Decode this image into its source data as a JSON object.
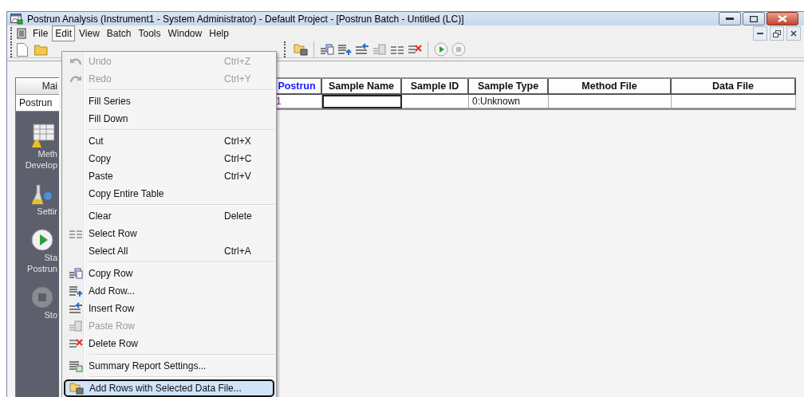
{
  "window": {
    "title": "Postrun Analysis (Instrument1 - System Administrator) - Default Project - [Postrun Batch - Untitled (LC)]"
  },
  "menubar": [
    {
      "label": "File",
      "selected": false
    },
    {
      "label": "Edit",
      "selected": true
    },
    {
      "label": "View",
      "selected": false
    },
    {
      "label": "Batch",
      "selected": false
    },
    {
      "label": "Tools",
      "selected": false
    },
    {
      "label": "Window",
      "selected": false
    },
    {
      "label": "Help",
      "selected": false
    }
  ],
  "sidebar": {
    "header": "Mai",
    "dropdown": "Postrun",
    "buttons": [
      {
        "lines": [
          "Meth",
          "Develop"
        ]
      },
      {
        "lines": [
          "Settir"
        ]
      },
      {
        "lines": [
          "Sta",
          "Postrun"
        ]
      },
      {
        "lines": [
          "Sto"
        ]
      }
    ]
  },
  "table": {
    "columns": [
      {
        "label": "Postrun",
        "kind": "index"
      },
      {
        "label": "Sample Name",
        "kind": "data"
      },
      {
        "label": "Sample ID",
        "kind": "data"
      },
      {
        "label": "Sample Type",
        "kind": "data"
      },
      {
        "label": "Method File",
        "kind": "data"
      },
      {
        "label": "Data File",
        "kind": "data"
      }
    ],
    "rows": [
      {
        "cells": [
          {
            "text": "1",
            "selected": false
          },
          {
            "selected": true
          },
          {
            "selected": false
          },
          {
            "text": "0:Unknown",
            "selected": false
          },
          {
            "selected": false
          },
          {
            "selected": false
          }
        ]
      }
    ]
  },
  "edit_menu": [
    {
      "kind": "item",
      "label": "Undo",
      "shortcut": "Ctrl+Z",
      "disabled": true,
      "selected": false
    },
    {
      "kind": "item",
      "label": "Redo",
      "shortcut": "Ctrl+Y",
      "disabled": true,
      "selected": false
    },
    {
      "kind": "separator"
    },
    {
      "kind": "item",
      "label": "Fill Series",
      "disabled": false,
      "selected": false
    },
    {
      "kind": "item",
      "label": "Fill Down",
      "disabled": false,
      "selected": false
    },
    {
      "kind": "separator"
    },
    {
      "kind": "item",
      "label": "Cut",
      "shortcut": "Ctrl+X",
      "disabled": false,
      "selected": false
    },
    {
      "kind": "item",
      "label": "Copy",
      "shortcut": "Ctrl+C",
      "disabled": false,
      "selected": false
    },
    {
      "kind": "item",
      "label": "Paste",
      "shortcut": "Ctrl+V",
      "disabled": false,
      "selected": false
    },
    {
      "kind": "item",
      "label": "Copy Entire Table",
      "disabled": false,
      "selected": false
    },
    {
      "kind": "separator"
    },
    {
      "kind": "item",
      "label": "Clear",
      "shortcut": "Delete",
      "disabled": false,
      "selected": false
    },
    {
      "kind": "item",
      "label": "Select Row",
      "disabled": false,
      "selected": false
    },
    {
      "kind": "item",
      "label": "Select All",
      "shortcut": "Ctrl+A",
      "disabled": false,
      "selected": false
    },
    {
      "kind": "separator"
    },
    {
      "kind": "item",
      "label": "Copy Row",
      "disabled": false,
      "selected": false
    },
    {
      "kind": "item",
      "label": "Add Row...",
      "disabled": false,
      "selected": false
    },
    {
      "kind": "item",
      "label": "Insert Row",
      "disabled": false,
      "selected": false
    },
    {
      "kind": "item",
      "label": "Paste Row",
      "disabled": true,
      "selected": false
    },
    {
      "kind": "item",
      "label": "Delete Row",
      "disabled": false,
      "selected": false
    },
    {
      "kind": "separator"
    },
    {
      "kind": "item",
      "label": "Summary Report Settings...",
      "disabled": false,
      "selected": false
    },
    {
      "kind": "separator"
    },
    {
      "kind": "item",
      "label": "Add Rows with Selected Data File...",
      "disabled": false,
      "selected": true
    }
  ]
}
